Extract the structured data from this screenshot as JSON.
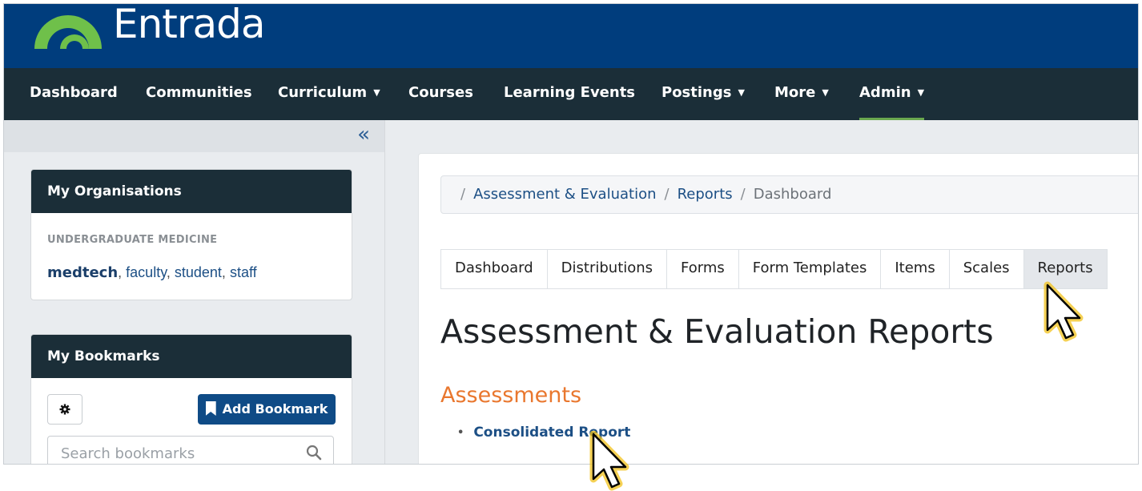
{
  "brand": {
    "name": "Entrada"
  },
  "nav": {
    "items": [
      {
        "label": "Dashboard"
      },
      {
        "label": "Communities"
      },
      {
        "label": "Curriculum"
      },
      {
        "label": "Courses"
      },
      {
        "label": "Learning Events"
      },
      {
        "label": "Postings"
      },
      {
        "label": "More"
      },
      {
        "label": "Admin"
      }
    ]
  },
  "sidebar": {
    "collapse_icon": "double-chevron-left-icon",
    "organisations": {
      "title": "My Organisations",
      "org_name": "UNDERGRADUATE MEDICINE",
      "roles": [
        "medtech",
        "faculty",
        "student",
        "staff"
      ]
    },
    "bookmarks": {
      "title": "My Bookmarks",
      "settings_icon": "gear-icon",
      "add_label": "Add Bookmark",
      "search_placeholder": "Search bookmarks"
    }
  },
  "breadcrumb": {
    "items": [
      "Assessment & Evaluation",
      "Reports"
    ],
    "current": "Dashboard"
  },
  "tabs": {
    "items": [
      "Dashboard",
      "Distributions",
      "Forms",
      "Form Templates",
      "Items",
      "Scales",
      "Reports"
    ],
    "active": "Reports"
  },
  "page": {
    "title": "Assessment & Evaluation Reports",
    "section": "Assessments",
    "reports": [
      "Consolidated Report"
    ]
  },
  "colors": {
    "brand_bar": "#003d7d",
    "nav_bar": "#1b2e38",
    "accent_green": "#6aa84f",
    "section_orange": "#e9772e",
    "link_blue": "#1c4f85"
  }
}
